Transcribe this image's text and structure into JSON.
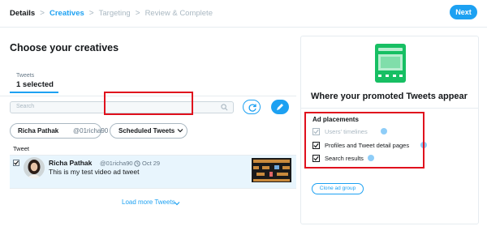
{
  "breadcrumb": {
    "steps": [
      "Details",
      "Creatives",
      "Targeting",
      "Review & Complete"
    ],
    "separator": ">"
  },
  "header": {
    "next_label": "Next"
  },
  "left": {
    "title": "Choose your creatives",
    "tab_label": "Tweets",
    "tab_value": "1 selected",
    "search_placeholder": "Search",
    "user_filter": {
      "name": "Richa Pathak",
      "handle": "@01richa90"
    },
    "scheduled_label": "Scheduled Tweets",
    "column_header": "Tweet",
    "tweet": {
      "name": "Richa Pathak",
      "handle": "@01richa90",
      "separator": "·",
      "date": "Oct 29",
      "text": "This is my test video ad tweet",
      "selected": true
    },
    "load_more": "Load more Tweets"
  },
  "right": {
    "title": "Where your promoted Tweets appear",
    "ad_placements_title": "Ad placements",
    "placements": [
      {
        "label": "Users' timelines",
        "checked": true,
        "disabled": true
      },
      {
        "label": "Profiles and Tweet detail pages",
        "checked": true,
        "disabled": false
      },
      {
        "label": "Search results",
        "checked": true,
        "disabled": false
      }
    ],
    "clone_label": "Clone ad group"
  },
  "colors": {
    "accent": "#1da1f2",
    "highlight_box": "#e0101d",
    "illustration": "#17bf63",
    "selected_row": "#e8f5fd"
  },
  "icons": [
    "chevron-right-icon",
    "search-icon",
    "refresh-icon",
    "compose-icon",
    "chevron-down-icon",
    "checkbox-icon",
    "clock-icon",
    "info-icon",
    "phone-illustration"
  ]
}
